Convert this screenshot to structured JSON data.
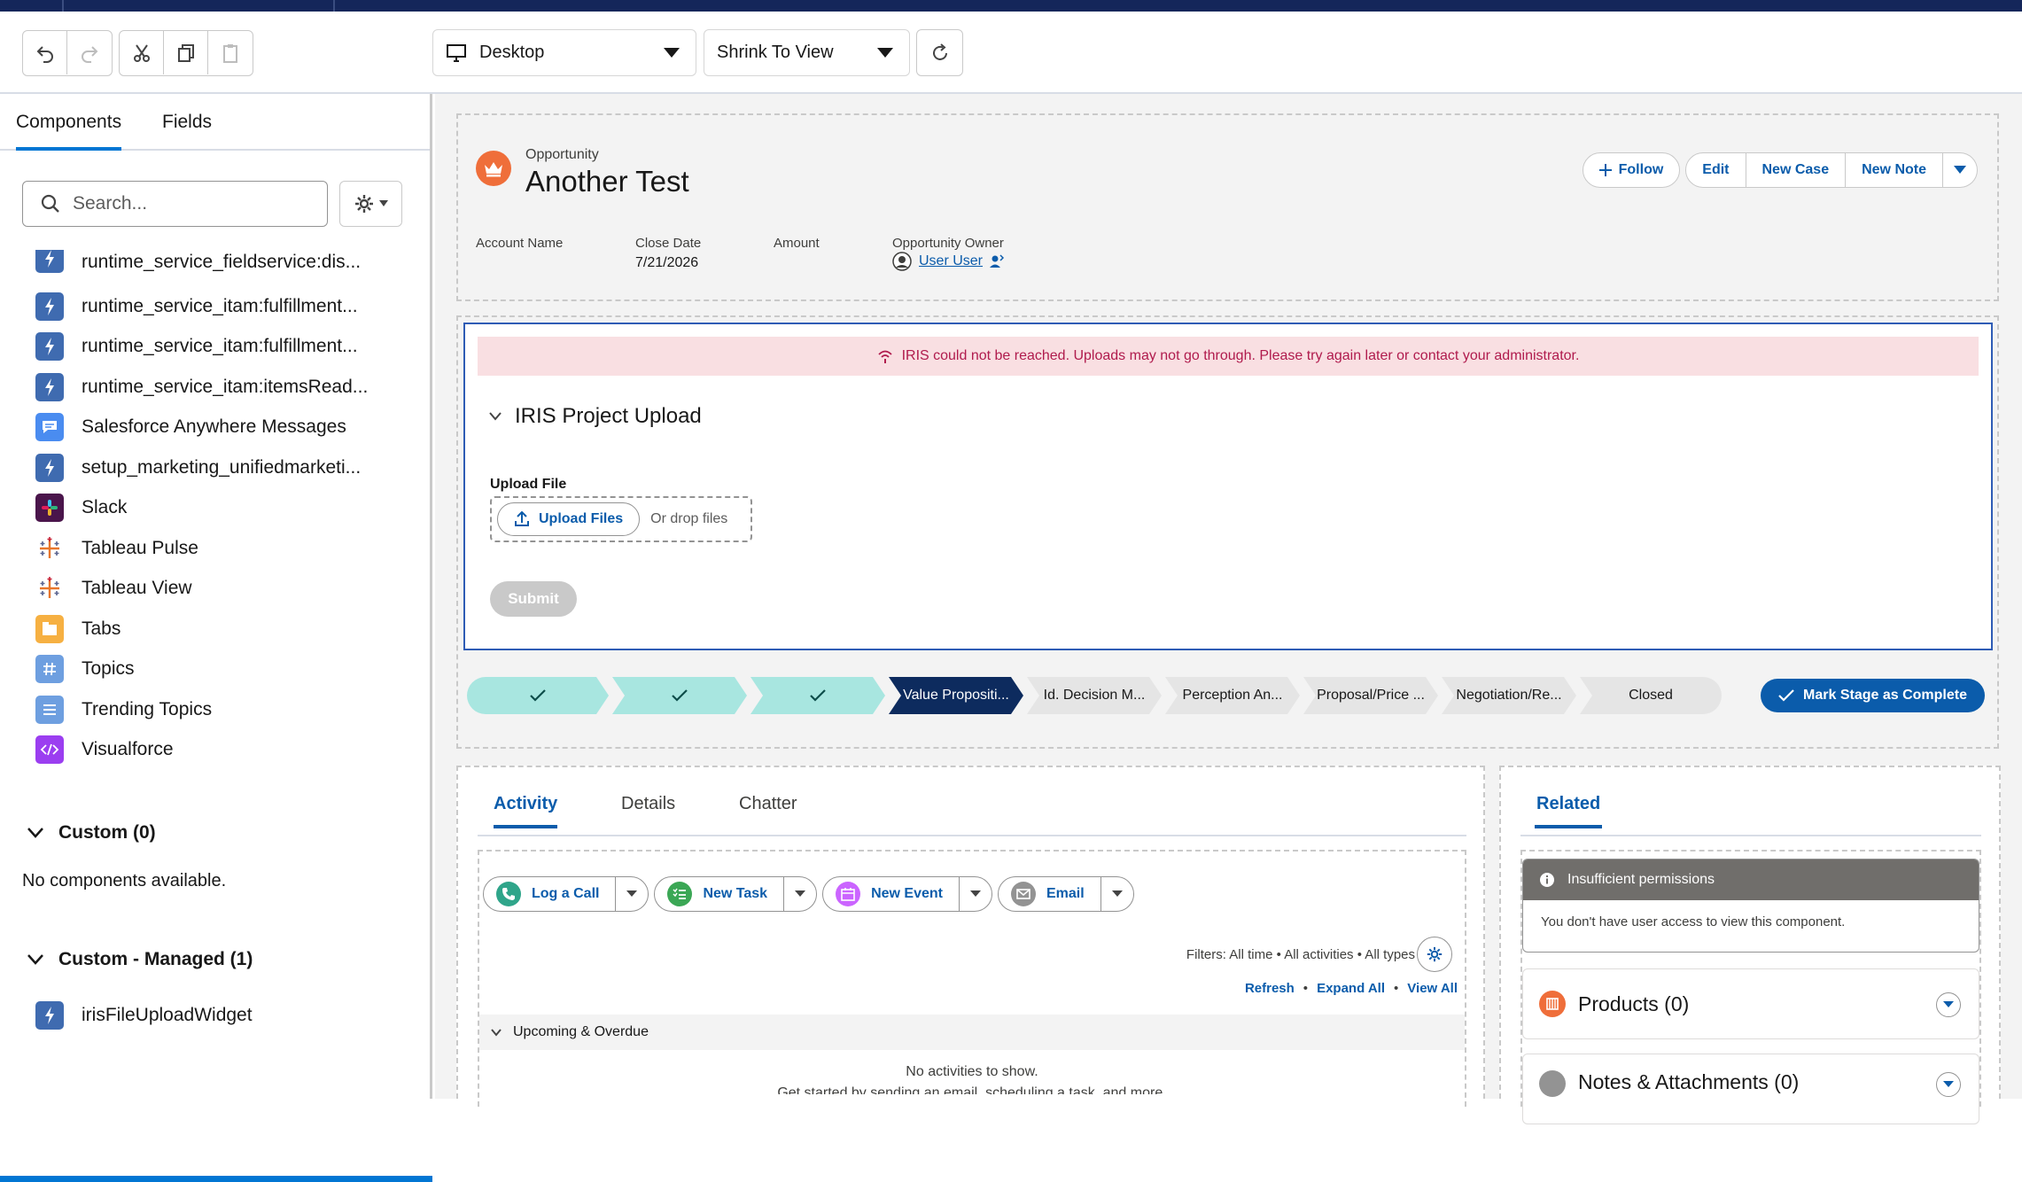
{
  "toolbar": {
    "device_select": "Desktop",
    "view_select": "Shrink To View"
  },
  "left_panel": {
    "tabs": [
      "Components",
      "Fields"
    ],
    "search_placeholder": "Search...",
    "components": [
      {
        "label": "runtime_service_fieldservice:dis...",
        "icon": "lightning-icon",
        "color": "#3f6bb0"
      },
      {
        "label": "runtime_service_itam:fulfillment...",
        "icon": "lightning-icon",
        "color": "#3f6bb0"
      },
      {
        "label": "runtime_service_itam:fulfillment...",
        "icon": "lightning-icon",
        "color": "#3f6bb0"
      },
      {
        "label": "runtime_service_itam:itemsRead...",
        "icon": "lightning-icon",
        "color": "#3f6bb0"
      },
      {
        "label": "Salesforce Anywhere Messages",
        "icon": "chat-icon",
        "color": "#4a8cf0"
      },
      {
        "label": "setup_marketing_unifiedmarketi...",
        "icon": "lightning-icon",
        "color": "#3f6bb0"
      },
      {
        "label": "Slack",
        "icon": "slack-icon",
        "color": "#4a154b"
      },
      {
        "label": "Tableau Pulse",
        "icon": "tableau-icon",
        "color": "#ffffff"
      },
      {
        "label": "Tableau View",
        "icon": "tableau-icon",
        "color": "#ffffff"
      },
      {
        "label": "Tabs",
        "icon": "tabs-icon",
        "color": "#f6b042"
      },
      {
        "label": "Topics",
        "icon": "hash-icon",
        "color": "#6e9fe0"
      },
      {
        "label": "Trending Topics",
        "icon": "list-icon",
        "color": "#6e9fe0"
      },
      {
        "label": "Visualforce",
        "icon": "code-icon",
        "color": "#9b3ef0"
      }
    ],
    "custom_section": "Custom (0)",
    "no_components": "No components available.",
    "managed_section": "Custom - Managed (1)",
    "managed_item": "irisFileUploadWidget"
  },
  "record": {
    "type": "Opportunity",
    "name": "Another Test",
    "actions": {
      "follow": "Follow",
      "edit": "Edit",
      "new_case": "New Case",
      "new_note": "New Note"
    },
    "fields": {
      "account_label": "Account Name",
      "close_label": "Close Date",
      "close_value": "7/21/2026",
      "amount_label": "Amount",
      "owner_label": "Opportunity Owner",
      "owner_value": "User User"
    }
  },
  "widget": {
    "alert": "IRIS could not be reached. Uploads may not go through. Please try again later or contact your administrator.",
    "title": "IRIS Project Upload",
    "upload_label": "Upload File",
    "upload_button": "Upload Files",
    "drop_text": "Or drop files",
    "submit": "Submit"
  },
  "path": {
    "steps": [
      {
        "label": "",
        "state": "done"
      },
      {
        "label": "",
        "state": "done"
      },
      {
        "label": "",
        "state": "done"
      },
      {
        "label": "Value Propositi...",
        "state": "current"
      },
      {
        "label": "Id. Decision M...",
        "state": "todo"
      },
      {
        "label": "Perception An...",
        "state": "todo"
      },
      {
        "label": "Proposal/Price ...",
        "state": "todo"
      },
      {
        "label": "Negotiation/Re...",
        "state": "todo"
      },
      {
        "label": "Closed",
        "state": "todo"
      }
    ],
    "mark_complete": "Mark Stage as Complete"
  },
  "activity": {
    "tabs": [
      "Activity",
      "Details",
      "Chatter"
    ],
    "publisher": {
      "log_call": "Log a Call",
      "new_task": "New Task",
      "new_event": "New Event",
      "email": "Email"
    },
    "filters": "Filters: All time • All activities • All types",
    "links": {
      "refresh": "Refresh",
      "expand_all": "Expand All",
      "view_all": "View All"
    },
    "upcoming": "Upcoming & Overdue",
    "no_activities": "No activities to show.",
    "get_started": "Get started by sending an email, scheduling a task, and more."
  },
  "related": {
    "tab": "Related",
    "perm_title": "Insufficient permissions",
    "perm_body": "You don't have user access to view this component.",
    "products": "Products (0)",
    "notes": "Notes & Attachments (0)"
  },
  "colors": {
    "brand": "#0b5cab",
    "accent": "#0176d3",
    "nav": "#14265a",
    "alert_bg": "#f9dfe2",
    "alert_text": "#b01b4d"
  }
}
